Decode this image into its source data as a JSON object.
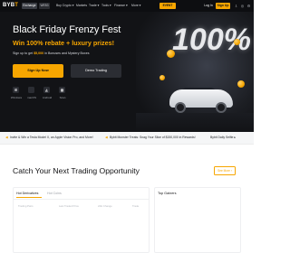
{
  "nav": {
    "logo_main": "BYB",
    "logo_accent": "T",
    "tabs": [
      "Exchange",
      "WEB3"
    ],
    "menu": [
      "Buy Crypto ▾",
      "Markets",
      "Trade ▾",
      "Tools ▾",
      "Finance ▾",
      "More ▾"
    ],
    "promo_label": "EVENT",
    "login_label": "Log In",
    "signup_label": "Sign Up"
  },
  "hero": {
    "title": "Black Friday Frenzy Fest",
    "subtitle": "Win 100% rebate + luxury prizes!",
    "desc_prefix": "Sign up to get ",
    "desc_amount": "$5,000",
    "desc_suffix": " in Bonuses and Mystery Boxes",
    "signup_button": "Sign Up Now",
    "demo_button": "Demo Trading",
    "platforms": [
      {
        "icon": "windows-icon",
        "label": "Windows"
      },
      {
        "icon": "apple-icon",
        "label": "macOS"
      },
      {
        "icon": "android-icon",
        "label": "Android"
      },
      {
        "icon": "qr-code-icon",
        "label": "Scan"
      }
    ],
    "big_text": "100%"
  },
  "ticker": [
    {
      "icon": "megaphone-icon",
      "text": "Invite & Win a Tesla Model X, an Apple Vision Pro, and More!"
    },
    {
      "icon": "megaphone-icon",
      "text": "Bybit Monster Treats: Snag Your Slice of $150,000 in Rewards!"
    },
    {
      "icon": "megaphone-icon",
      "text": "Bybit Daily Selfie ▸"
    }
  ],
  "section": {
    "title": "Catch Your Next Trading Opportunity",
    "more_button": "See More ›",
    "tabs": [
      "Hot Derivatives",
      "Hot Coins"
    ],
    "columns": [
      "Trading Pairs",
      "Last Traded Price",
      "24H Change",
      "Trade"
    ],
    "gainers_title": "Top Gainers"
  },
  "colors": {
    "accent": "#f7a600",
    "nav_bg": "#0d0e11",
    "hero_bg": "#121316",
    "text_dark": "#121214"
  }
}
